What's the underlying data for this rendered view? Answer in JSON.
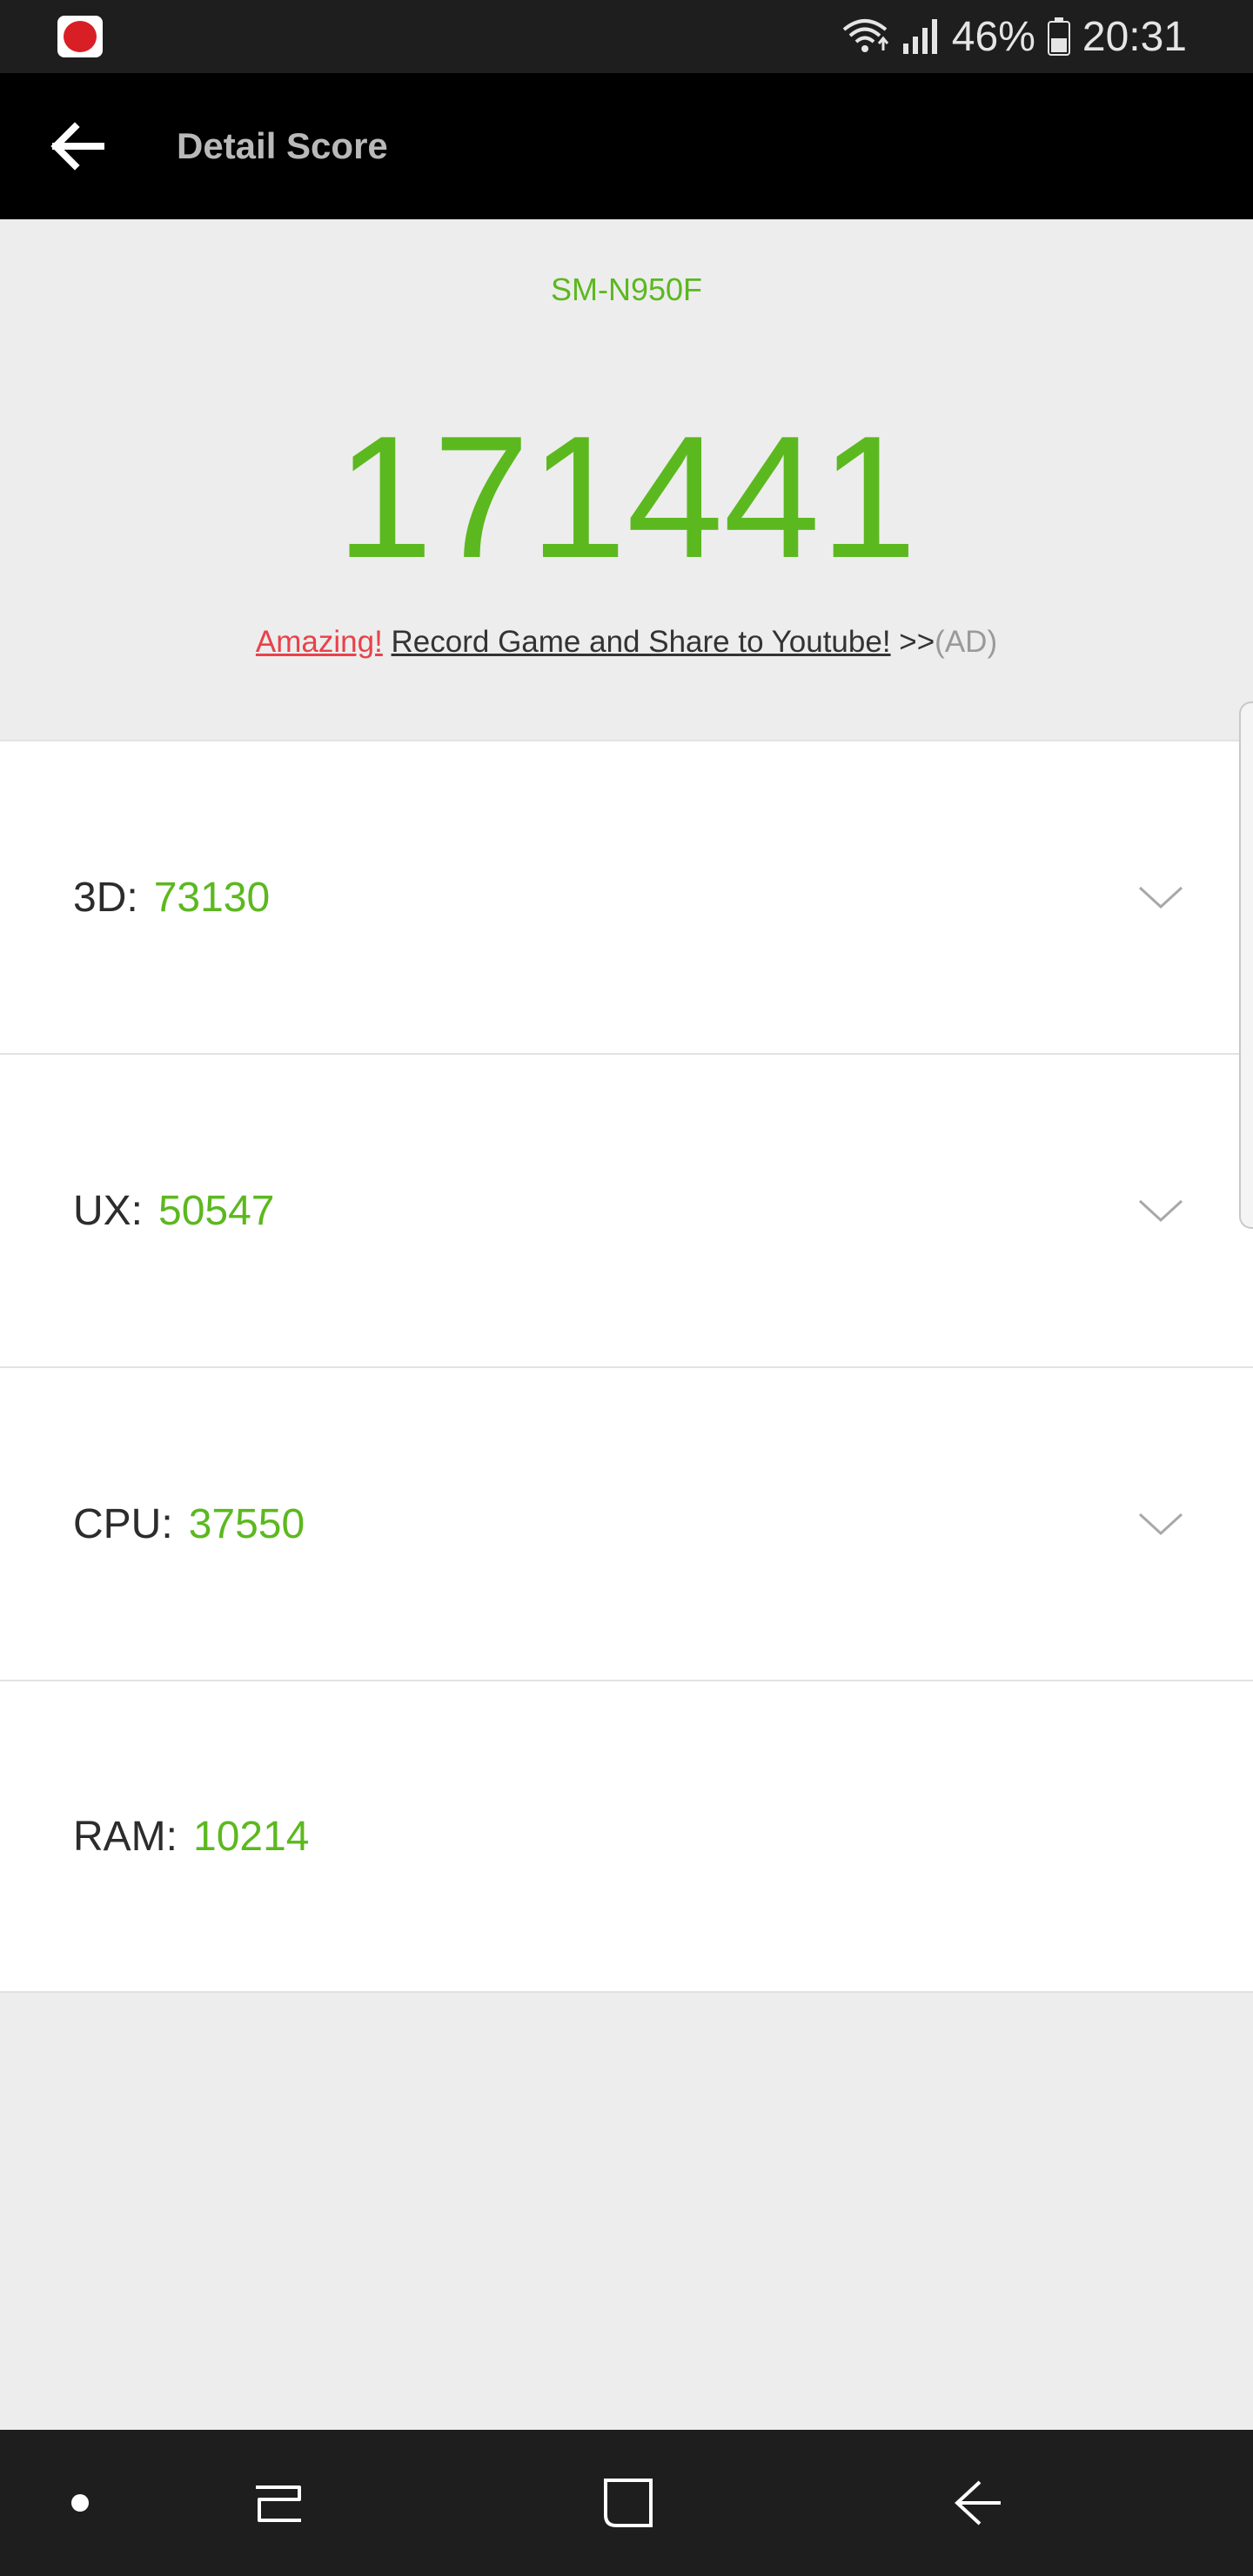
{
  "status_bar": {
    "battery": "46%",
    "time": "20:31",
    "icons": [
      "antutu-app-icon",
      "wifi-icon",
      "signal-icon",
      "battery-icon"
    ]
  },
  "app_bar": {
    "title": "Detail Score",
    "back_icon": "arrow-left-icon"
  },
  "header": {
    "device_model": "SM-N950F",
    "total_score": "171441",
    "ad": {
      "amazing": "Amazing!",
      "record_text": "Record Game and Share to Youtube!",
      "arrows": ">>",
      "ad_tag": "(AD)"
    }
  },
  "scores": [
    {
      "name": "3D:",
      "value": "73130",
      "expandable": true
    },
    {
      "name": "UX:",
      "value": "50547",
      "expandable": true
    },
    {
      "name": "CPU:",
      "value": "37550",
      "expandable": true
    },
    {
      "name": "RAM:",
      "value": "10214",
      "expandable": false
    }
  ],
  "nav_bar": {
    "icons": [
      "dot-icon",
      "recent-apps-icon",
      "home-icon",
      "back-icon"
    ]
  },
  "colors": {
    "accent_green": "#5cb81f",
    "ad_red": "#e8424a",
    "bar_black": "#000000",
    "system_bar": "#1e1e1e",
    "background": "#ededed"
  }
}
